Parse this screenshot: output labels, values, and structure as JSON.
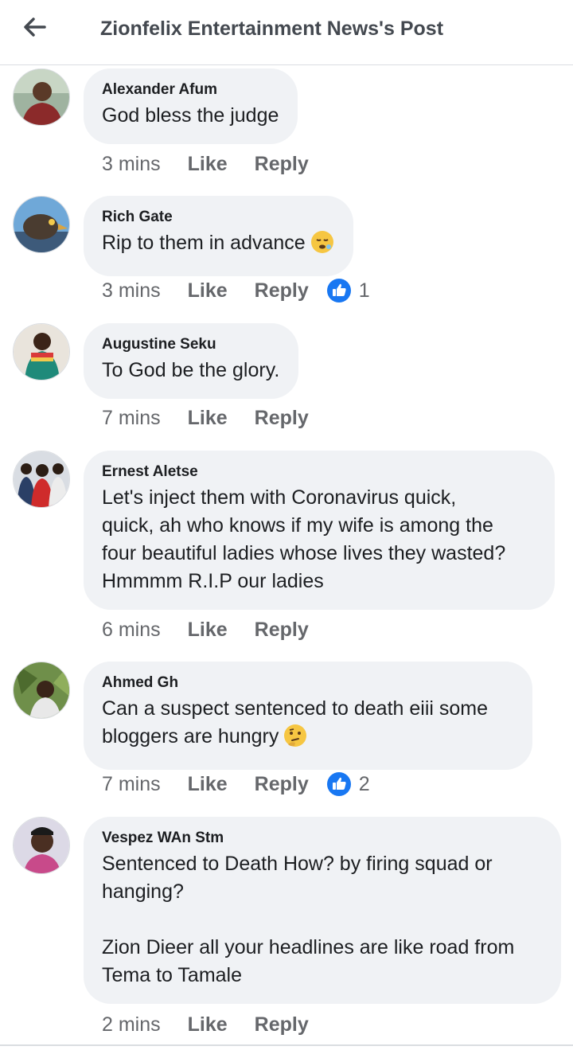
{
  "header": {
    "title": "Zionfelix Entertainment News's Post",
    "back_icon": "arrow-left-icon"
  },
  "comments": [
    {
      "author": "Alexander Afum",
      "text": "God bless the judge",
      "time": "3 mins",
      "like": "Like",
      "reply": "Reply",
      "reactions": ""
    },
    {
      "author": "Rich Gate",
      "text": "Rip to them in advance",
      "emoji": "sleepy-face-icon",
      "time": "3 mins",
      "like": "Like",
      "reply": "Reply",
      "reactions": "1"
    },
    {
      "author": "Augustine Seku",
      "text": "To God be the glory.",
      "time": "7 mins",
      "like": "Like",
      "reply": "Reply",
      "reactions": ""
    },
    {
      "author": "Ernest Aletse",
      "text": "Let's inject them with Coronavirus quick,\nquick, ah who knows if my wife is among the\nfour beautiful ladies whose lives they wasted?\nHmmmm R.I.P our ladies",
      "time": "6 mins",
      "like": "Like",
      "reply": "Reply",
      "reactions": ""
    },
    {
      "author": "Ahmed Gh",
      "text": "Can a suspect sentenced to death eiii some\nbloggers are hungry",
      "emoji": "thinking-face-icon",
      "time": "7 mins",
      "like": "Like",
      "reply": "Reply",
      "reactions": "2"
    },
    {
      "author": "Vespez WAn Stm",
      "text": "Sentenced to Death How? by firing squad or\nhanging?\n\nZion Dieer all your headlines are like road from\nTema to Tamale",
      "time": "2 mins",
      "like": "Like",
      "reply": "Reply",
      "reactions": ""
    }
  ],
  "colors": {
    "bubble": "#f0f2f5",
    "like_blue": "#1877f2",
    "meta_gray": "#65676b"
  }
}
